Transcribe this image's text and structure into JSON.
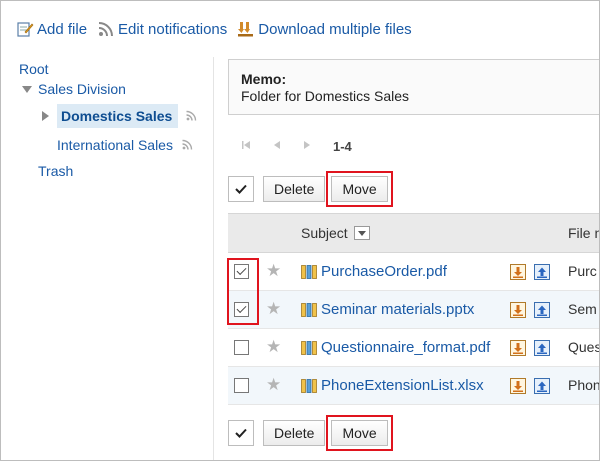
{
  "toolbar": {
    "add_file": "Add file",
    "edit_notifications": "Edit notifications",
    "download_multiple": "Download multiple files"
  },
  "tree": {
    "root": "Root",
    "sales_division": "Sales Division",
    "domestics_sales": "Domestics Sales",
    "international_sales": "International Sales",
    "trash": "Trash"
  },
  "memo": {
    "title": "Memo:",
    "text": "Folder for Domestics Sales"
  },
  "pager": {
    "range": "1-4"
  },
  "actions": {
    "delete": "Delete",
    "move": "Move"
  },
  "table": {
    "col_subject": "Subject",
    "col_file": "File n",
    "rows": [
      {
        "name": "PurchaseOrder.pdf",
        "snippet": "Purc",
        "checked": true
      },
      {
        "name": "Seminar materials.pptx",
        "snippet": "Sem",
        "checked": true
      },
      {
        "name": "Questionnaire_format.pdf",
        "snippet": "Ques",
        "checked": false
      },
      {
        "name": "PhoneExtensionList.xlsx",
        "snippet": "Phon",
        "checked": false
      }
    ]
  },
  "colors": {
    "link": "#1a5aa6",
    "highlight": "#e0141e",
    "selected_bg": "#dceaf5"
  }
}
